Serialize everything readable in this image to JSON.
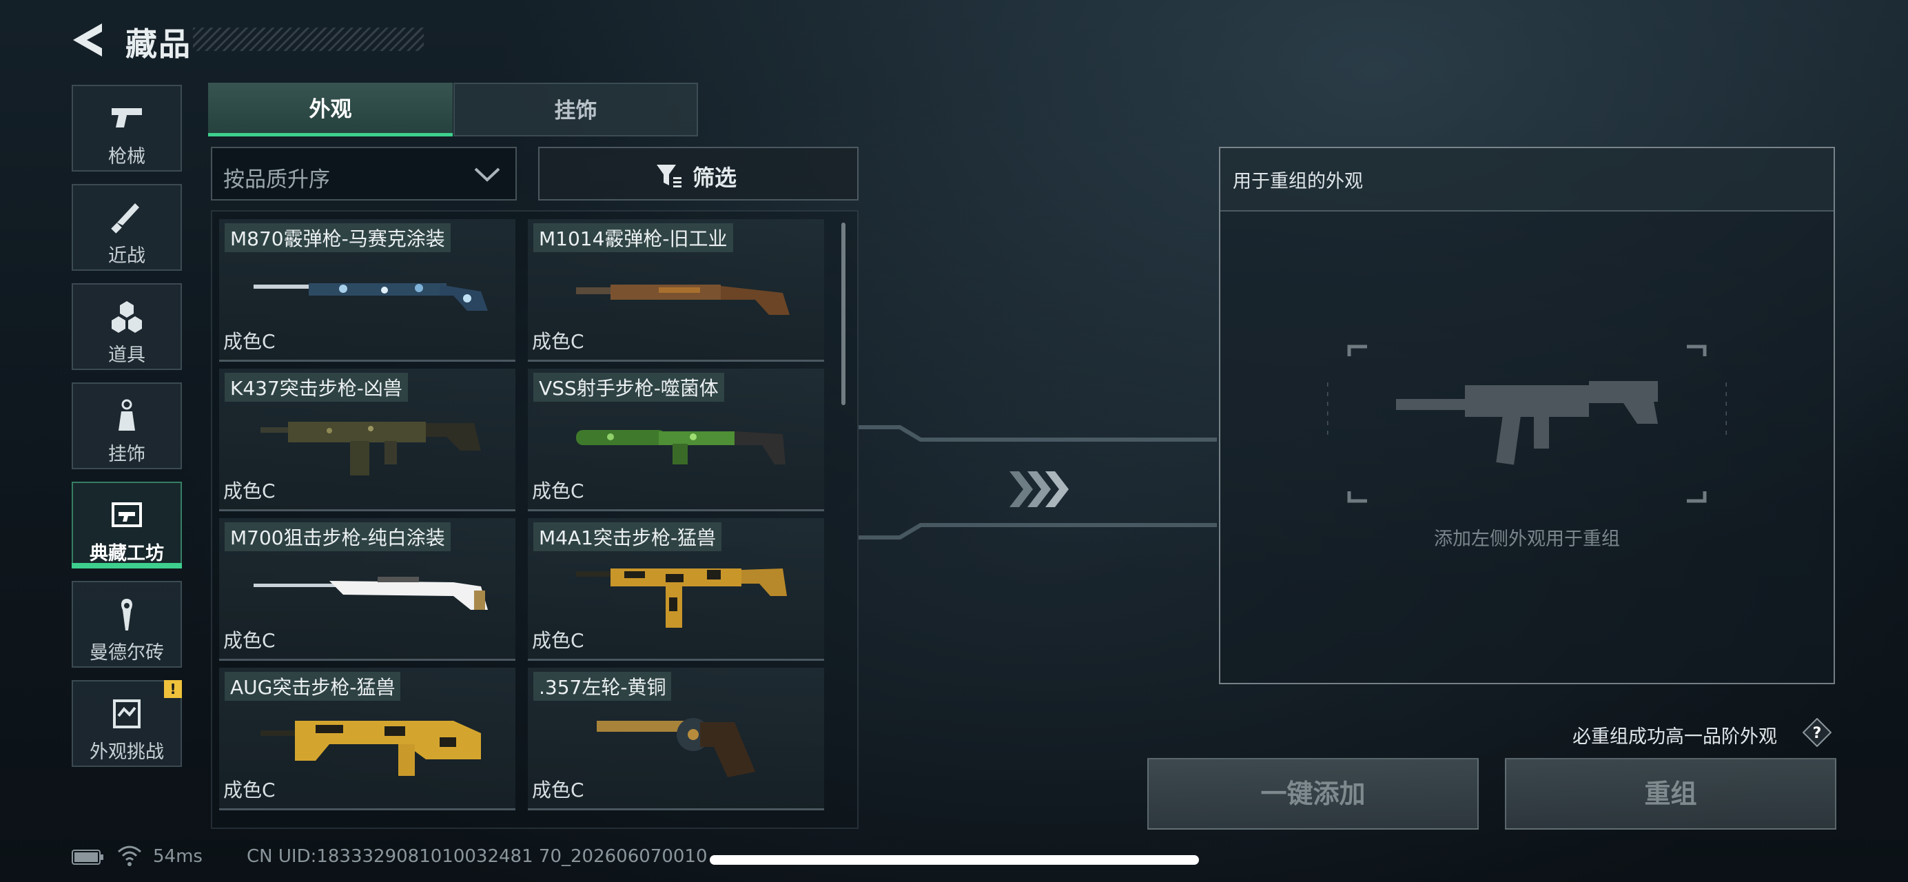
{
  "header": {
    "title": "藏品"
  },
  "nav": {
    "items": [
      {
        "label": "枪械",
        "icon": "pistol-icon",
        "active": false
      },
      {
        "label": "近战",
        "icon": "knife-icon",
        "active": false
      },
      {
        "label": "道具",
        "icon": "grenade-icon",
        "active": false
      },
      {
        "label": "挂饰",
        "icon": "keychain-icon",
        "active": false
      },
      {
        "label": "典藏工坊",
        "icon": "workshop-icon",
        "active": true
      },
      {
        "label": "曼德尔砖",
        "icon": "mandel-brick-icon",
        "active": false
      },
      {
        "label": "外观挑战",
        "icon": "challenge-icon",
        "active": false,
        "badge": "!"
      }
    ]
  },
  "tabs": [
    {
      "label": "外观",
      "active": true
    },
    {
      "label": "挂饰",
      "active": false
    }
  ],
  "controls": {
    "sort_label": "按品质升序",
    "filter_label": "筛选"
  },
  "items": [
    {
      "name": "M870霰弹枪-马赛克涂装",
      "grade": "成色C"
    },
    {
      "name": "M1014霰弹枪-旧工业",
      "grade": "成色C"
    },
    {
      "name": "K437突击步枪-凶兽",
      "grade": "成色C"
    },
    {
      "name": "VSS射手步枪-噬菌体",
      "grade": "成色C"
    },
    {
      "name": "M700狙击步枪-纯白涂装",
      "grade": "成色C"
    },
    {
      "name": "M4A1突击步枪-猛兽",
      "grade": "成色C"
    },
    {
      "name": "AUG突击步枪-猛兽",
      "grade": "成色C"
    },
    {
      "name": ".357左轮-黄铜",
      "grade": "成色C"
    }
  ],
  "recompose": {
    "panel_title": "用于重组的外观",
    "placeholder": "添加左侧外观用于重组",
    "guarantee_text": "必重组成功高一品阶外观",
    "help_label": "?",
    "add_all_label": "一键添加",
    "recompose_label": "重组"
  },
  "status": {
    "ping": "54ms",
    "uid": "CN UID:1833329081010032481 70_202606070010"
  },
  "colors": {
    "accent": "#3ecf8e",
    "badge": "#f0c23b"
  }
}
